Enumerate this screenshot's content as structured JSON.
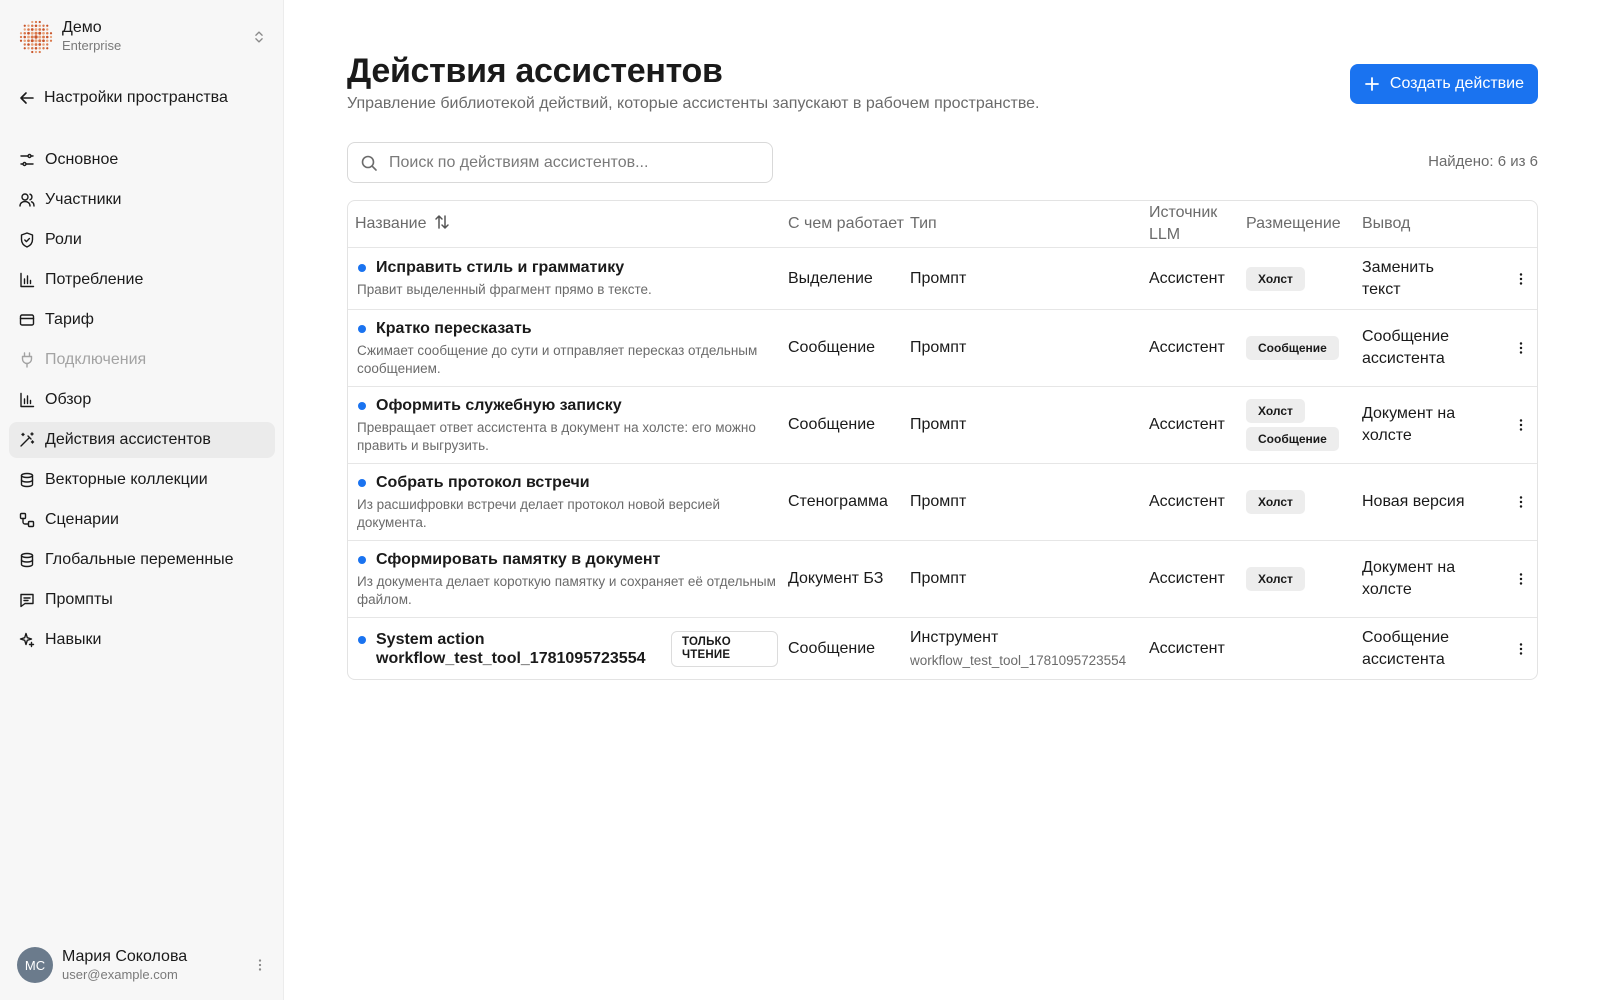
{
  "workspace": {
    "name": "Демо",
    "plan": "Enterprise"
  },
  "sidebar": {
    "back_label": "Настройки пространства",
    "items": [
      {
        "label": "Основное",
        "icon": "sliders-icon",
        "state": "normal"
      },
      {
        "label": "Участники",
        "icon": "users-icon",
        "state": "normal"
      },
      {
        "label": "Роли",
        "icon": "shield-icon",
        "state": "normal"
      },
      {
        "label": "Потребление",
        "icon": "bar-chart-icon",
        "state": "normal"
      },
      {
        "label": "Тариф",
        "icon": "credit-card-icon",
        "state": "normal"
      },
      {
        "label": "Подключения",
        "icon": "plug-icon",
        "state": "disabled"
      },
      {
        "label": "Обзор",
        "icon": "bar-chart-icon",
        "state": "normal"
      },
      {
        "label": "Действия ассистентов",
        "icon": "magic-wand-icon",
        "state": "active"
      },
      {
        "label": "Векторные коллекции",
        "icon": "database-icon",
        "state": "normal"
      },
      {
        "label": "Сценарии",
        "icon": "workflow-icon",
        "state": "normal"
      },
      {
        "label": "Глобальные переменные",
        "icon": "database-icon",
        "state": "normal"
      },
      {
        "label": "Промпты",
        "icon": "message-icon",
        "state": "normal"
      },
      {
        "label": "Навыки",
        "icon": "sparkles-icon",
        "state": "normal"
      }
    ]
  },
  "user": {
    "initials": "МС",
    "name": "Мария Соколова",
    "email": "user@example.com"
  },
  "header": {
    "title": "Действия ассистентов",
    "subtitle": "Управление библиотекой действий, которые ассистенты запускают в рабочем пространстве.",
    "create_label": "Создать действие"
  },
  "search": {
    "placeholder": "Поиск по действиям ассистентов...",
    "value": ""
  },
  "found_label": "Найдено: 6 из 6",
  "colors": {
    "accent": "#1a73f0",
    "sidebar_bg": "#f7f7f7",
    "active_item_bg": "#ebebeb"
  },
  "table": {
    "headers": {
      "name": "Название",
      "with": "С чем работает",
      "type": "Тип",
      "source": "Источник LLM",
      "placement": "Размещение",
      "output": "Вывод"
    },
    "rows": [
      {
        "title": "Исправить стиль и грамматику",
        "description": "Правит выделенный фрагмент прямо в тексте.",
        "with": "Выделение",
        "type": "Промпт",
        "type_detail": "",
        "source": "Ассистент",
        "placements": [
          "Холст"
        ],
        "output": "Заменить текст",
        "badge": ""
      },
      {
        "title": "Кратко пересказать",
        "description": "Сжимает сообщение до сути и отправляет пересказ отдельным сообщением.",
        "with": "Сообщение",
        "type": "Промпт",
        "type_detail": "",
        "source": "Ассистент",
        "placements": [
          "Сообщение"
        ],
        "output": "Сообщение ассистента",
        "badge": ""
      },
      {
        "title": "Оформить служебную записку",
        "description": "Превращает ответ ассистента в документ на холсте: его можно править и выгрузить.",
        "with": "Сообщение",
        "type": "Промпт",
        "type_detail": "",
        "source": "Ассистент",
        "placements": [
          "Холст",
          "Сообщение"
        ],
        "output": "Документ на холсте",
        "badge": ""
      },
      {
        "title": "Собрать протокол встречи",
        "description": "Из расшифровки встречи делает протокол новой версией документа.",
        "with": "Стенограмма",
        "type": "Промпт",
        "type_detail": "",
        "source": "Ассистент",
        "placements": [
          "Холст"
        ],
        "output": "Новая версия",
        "badge": ""
      },
      {
        "title": "Сформировать памятку в документ",
        "description": "Из документа делает короткую памятку и сохраняет её отдельным файлом.",
        "with": "Документ БЗ",
        "type": "Промпт",
        "type_detail": "",
        "source": "Ассистент",
        "placements": [
          "Холст"
        ],
        "output": "Документ на холсте",
        "badge": ""
      },
      {
        "title": "System action workflow_test_tool_1781095723554",
        "description": "",
        "with": "Сообщение",
        "type": "Инструмент",
        "type_detail": "workflow_test_tool_1781095723554",
        "source": "Ассистент",
        "placements": [],
        "output": "Сообщение ассистента",
        "badge": "ТОЛЬКО ЧТЕНИЕ"
      }
    ]
  }
}
